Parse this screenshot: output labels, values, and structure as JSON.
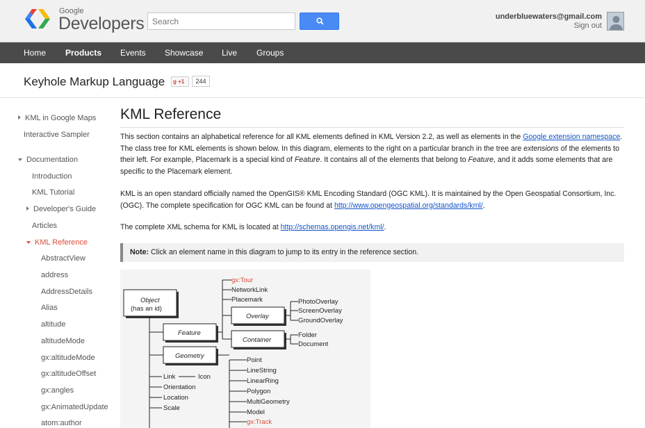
{
  "header": {
    "brand_small": "Google",
    "brand_big": "Developers",
    "search_placeholder": "Search",
    "search_icon": "magnifier-icon",
    "email": "underbluewaters@gmail.com",
    "signout": "Sign out"
  },
  "nav": {
    "items": [
      "Home",
      "Products",
      "Events",
      "Showcase",
      "Live",
      "Groups"
    ],
    "active": "Products"
  },
  "product": {
    "title": "Keyhole Markup Language",
    "plusone_label": "+1",
    "plusone_count": "244"
  },
  "sidebar": {
    "items": [
      {
        "label": "KML in Google Maps",
        "arrow": "right"
      },
      {
        "label": "Interactive Sampler"
      },
      {
        "label": "Documentation",
        "arrow": "down"
      },
      {
        "label": "Introduction"
      },
      {
        "label": "KML Tutorial"
      },
      {
        "label": "Developer's Guide",
        "arrow": "right"
      },
      {
        "label": "Articles"
      },
      {
        "label": "KML Reference",
        "arrow": "down",
        "active": true
      },
      {
        "label": "AbstractView"
      },
      {
        "label": "address"
      },
      {
        "label": "AddressDetails"
      },
      {
        "label": "Alias"
      },
      {
        "label": "altitude"
      },
      {
        "label": "altitudeMode"
      },
      {
        "label": "gx:altitudeMode"
      },
      {
        "label": "gx:altitudeOffset"
      },
      {
        "label": "gx:angles"
      },
      {
        "label": "gx:AnimatedUpdate"
      },
      {
        "label": "atom:author"
      }
    ]
  },
  "main": {
    "title": "KML Reference",
    "p1": {
      "a": "This section contains an alphabetical reference for all KML elements defined in KML Version 2.2, as well as elements in the ",
      "link": "Google extension namespace",
      "b": ". The class tree for KML elements is shown below. In this diagram, elements to the right on a particular branch in the tree are ",
      "em1": "extensions",
      "c": " of the elements to their left. For example, Placemark is a special kind of ",
      "em2": "Feature",
      "d": ". It contains all of the elements that belong to ",
      "em3": "Feature",
      "e": ", and it adds some elements that are specific to the Placemark element."
    },
    "p2": {
      "a": "KML is an open standard officially named the OpenGIS® KML Encoding Standard (OGC KML). It is maintained by the Open Geospatial Consortium, Inc. (OGC). The complete specification for OGC KML can be found at ",
      "link": "http://www.opengeospatial.org/standards/kml/",
      "b": "."
    },
    "p3": {
      "a": "The complete XML schema for KML is located at ",
      "link": "http://schemas.opengis.net/kml/",
      "b": "."
    },
    "note": {
      "label": "Note:",
      "text": " Click an element name in this diagram to jump to its entry in the reference section."
    }
  },
  "diagram": {
    "object_line1": "Object",
    "object_line2a": "(has an ",
    "object_line2b": "id",
    "object_line2c": ")",
    "feature": "Feature",
    "geometry": "Geometry",
    "overlay": "Overlay",
    "container": "Container",
    "feature_children": [
      "gx:Tour",
      "NetworkLink",
      "Placemark"
    ],
    "overlay_children": [
      "PhotoOverlay",
      "ScreenOverlay",
      "GroundOverlay"
    ],
    "container_children": [
      "Folder",
      "Document"
    ],
    "geometry_children": [
      "Point",
      "LineString",
      "LinearRing",
      "Polygon",
      "MultiGeometry",
      "Model",
      "gx:Track"
    ],
    "object_children": [
      "Link",
      "Icon",
      "Orientation",
      "Location",
      "Scale"
    ]
  }
}
